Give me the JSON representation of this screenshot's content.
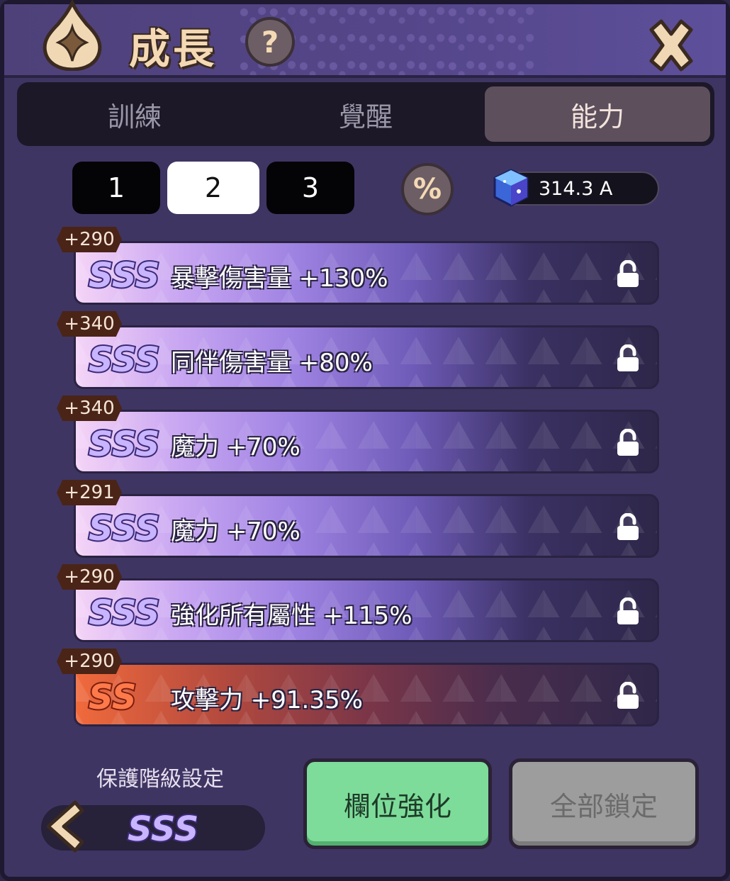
{
  "header": {
    "title": "成長",
    "help_glyph": "?",
    "close_icon": "close-icon"
  },
  "tabs": [
    {
      "label": "訓練",
      "active": false
    },
    {
      "label": "覺醒",
      "active": false
    },
    {
      "label": "能力",
      "active": true
    }
  ],
  "pages": [
    {
      "label": "1",
      "active": false
    },
    {
      "label": "2",
      "active": true
    },
    {
      "label": "3",
      "active": false
    }
  ],
  "percent_label": "%",
  "currency": {
    "icon": "cube-gem-icon",
    "amount": "314.3 A"
  },
  "stats": [
    {
      "badge": "+290",
      "grade": "SSS",
      "text": "暴擊傷害量 +130%",
      "locked": false
    },
    {
      "badge": "+340",
      "grade": "SSS",
      "text": "同伴傷害量 +80%",
      "locked": false
    },
    {
      "badge": "+340",
      "grade": "SSS",
      "text": "魔力 +70%",
      "locked": false
    },
    {
      "badge": "+291",
      "grade": "SSS",
      "text": "魔力 +70%",
      "locked": false
    },
    {
      "badge": "+290",
      "grade": "SSS",
      "text": "強化所有屬性 +115%",
      "locked": false
    },
    {
      "badge": "+290",
      "grade": "SS",
      "text": "攻擊力 +91.35%",
      "locked": false
    }
  ],
  "protect": {
    "label": "保護階級設定",
    "grade": "SSS"
  },
  "buttons": {
    "enhance": "欄位強化",
    "lock_all": "全部鎖定"
  },
  "colors": {
    "enhance_green": "#7ddc99",
    "disabled_gray": "#9d9d9d",
    "title_gold": "#f4d9b4"
  }
}
